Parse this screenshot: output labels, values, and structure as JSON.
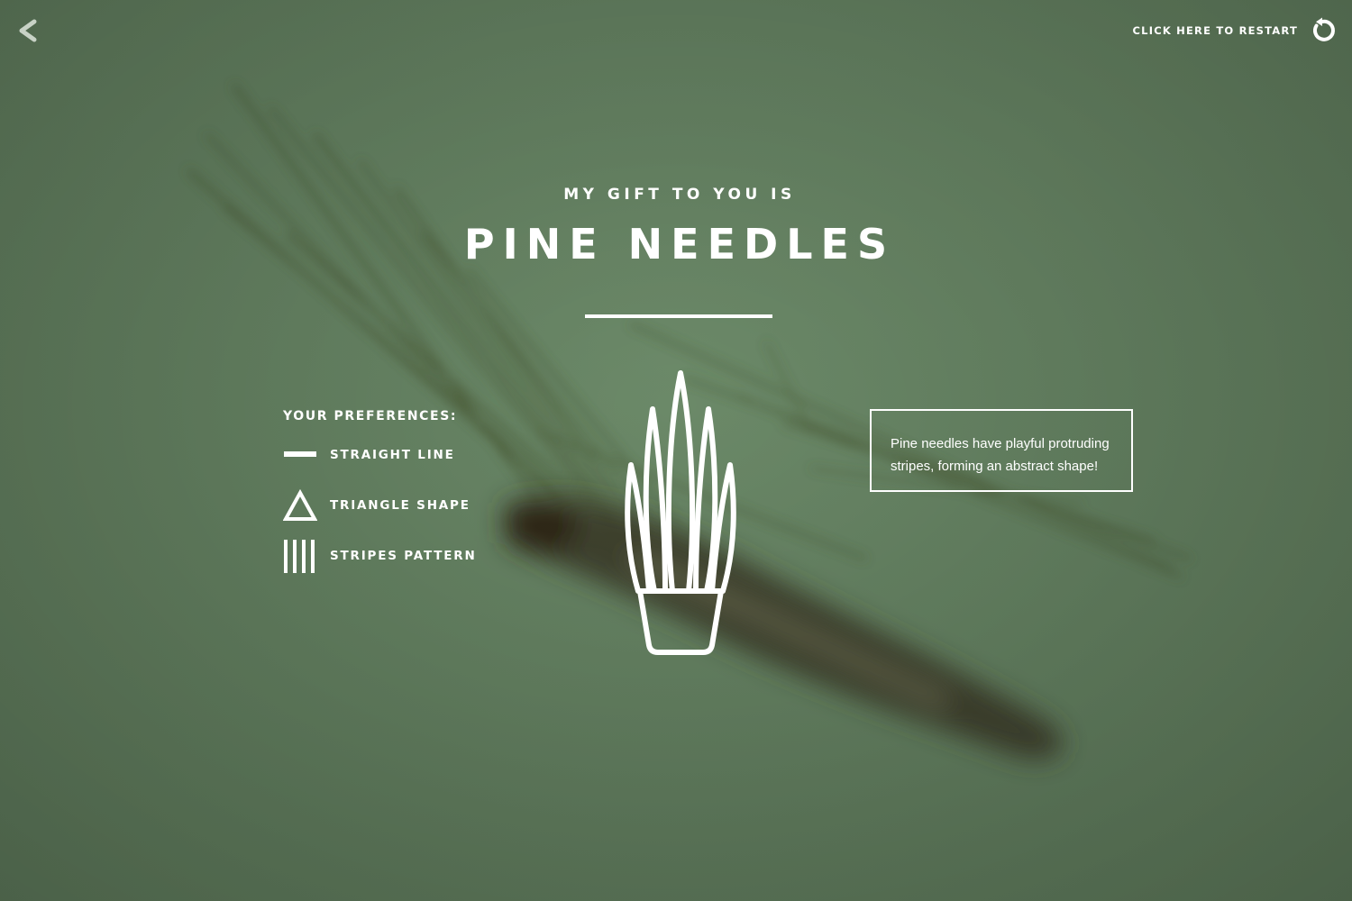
{
  "nav": {
    "back_icon": "chevron-left-icon",
    "restart_label": "CLICK HERE TO RESTART",
    "restart_icon": "restart-icon"
  },
  "result": {
    "pre_title": "MY GIFT TO YOU IS",
    "title": "PINE NEEDLES",
    "illustration_icon": "pine-needles-pot-icon"
  },
  "preferences": {
    "heading": "YOUR PREFERENCES:",
    "items": [
      {
        "label": "STRAIGHT LINE",
        "icon": "straight-line-icon"
      },
      {
        "label": "TRIANGLE SHAPE",
        "icon": "triangle-icon"
      },
      {
        "label": "STRIPES PATTERN",
        "icon": "stripes-icon"
      }
    ]
  },
  "info": {
    "description": "Pine needles have playful protruding stripes, forming an abstract shape!"
  },
  "colors": {
    "background": "#668363",
    "foreground": "#ffffff"
  }
}
